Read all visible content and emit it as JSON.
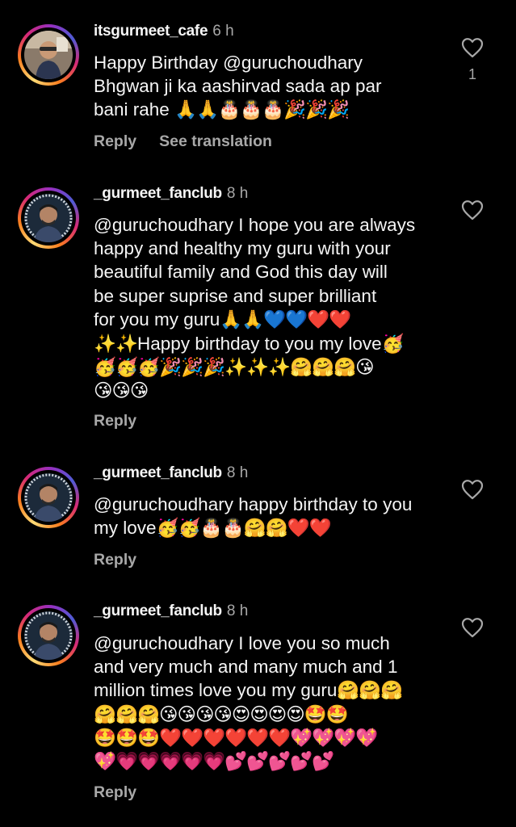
{
  "comments": [
    {
      "username": "itsgurmeet_cafe",
      "time": "6 h",
      "mention": "@guruchoudhary",
      "text_before": "Happy Birthday ",
      "text_after": "",
      "line2": "Bhgwan ji ka aashirvad sada ap par",
      "line3_text": "bani rahe ",
      "line3_emoji": "🙏🙏🎂🎂🎂🎉🎉🎉",
      "reply_label": "Reply",
      "see_translation_label": "See translation",
      "like_count": "1"
    },
    {
      "username": "_gurmeet_fanclub",
      "time": "8 h",
      "mention": "@guruchoudhary",
      "lines": [
        " I hope you are always",
        "happy and healthy my guru with your",
        "beautiful family and God this day will",
        "be super suprise and super brilliant",
        "for you my guru"
      ],
      "line5_emoji": "🙏🙏💙💙❤️❤️",
      "line6_emoji_a": "✨✨",
      "line6_text": "Happy birthday to you my love",
      "line6_emoji_b": "🥳",
      "line7_emoji": "🥳🥳🥳🎉🎉🎉✨✨✨🤗🤗🤗😘",
      "line8_emoji": "😘😘😘",
      "reply_label": "Reply"
    },
    {
      "username": "_gurmeet_fanclub",
      "time": "8 h",
      "mention": "@guruchoudhary",
      "line1_text": " happy birthday to you",
      "line2_text": "my love",
      "line2_emoji": "🥳🥳🎂🎂🤗🤗❤️❤️",
      "reply_label": "Reply"
    },
    {
      "username": "_gurmeet_fanclub",
      "time": "8 h",
      "mention": "@guruchoudhary",
      "line1_text": " I love you so much",
      "line2_text": "and very much and many much and 1",
      "line3_text": "million times love you my guru",
      "line3_emoji": "🤗🤗🤗",
      "line4_emoji": "🤗🤗🤗😘😘😘😘😍😍😍😍🤩🤩",
      "line5_emoji": "🤩🤩🤩❤️❤️❤️❤️❤️❤️💖💖💖💖",
      "line6_emoji": "💖💗💗💗💗💗💕💕💕💕💕",
      "reply_label": "Reply"
    }
  ]
}
